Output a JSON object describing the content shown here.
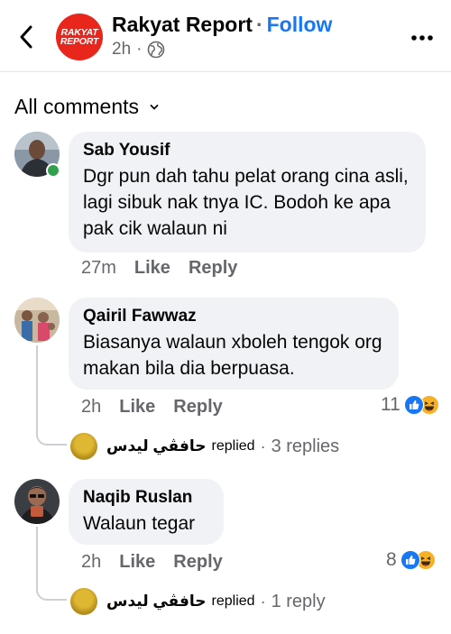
{
  "header": {
    "logo_line1": "RAKYAT",
    "logo_line2": "REPORT",
    "page_name": "Rakyat Report",
    "separator": "·",
    "follow_label": "Follow",
    "time": "2h",
    "time_sep": "·",
    "privacy_icon": "globe-icon"
  },
  "filter": {
    "label": "All comments"
  },
  "comments": [
    {
      "author": "Sab Yousif",
      "text": "Dgr pun dah tahu pelat orang cina asli, lagi sibuk nak tnya IC. Bodoh ke apa pak cik walaun ni",
      "time": "27m",
      "like_label": "Like",
      "reply_label": "Reply",
      "online": true
    },
    {
      "author": "Qairil Fawwaz",
      "text": "Biasanya walaun xboleh tengok org makan bila dia berpuasa.",
      "time": "2h",
      "like_label": "Like",
      "reply_label": "Reply",
      "reaction_count": "11",
      "reactions": [
        "like-icon",
        "haha-icon"
      ],
      "replies": {
        "replier_name": "حافڤي ليدس",
        "replied_word": "replied",
        "sep": "·",
        "count_text": "3 replies"
      }
    },
    {
      "author": "Naqib Ruslan",
      "text": "Walaun tegar",
      "time": "2h",
      "like_label": "Like",
      "reply_label": "Reply",
      "reaction_count": "8",
      "reactions": [
        "like-icon",
        "haha-icon"
      ],
      "replies": {
        "replier_name": "حافڤي ليدس",
        "replied_word": "replied",
        "sep": "·",
        "count_text": "1 reply"
      }
    }
  ],
  "colors": {
    "accent": "#1877f2",
    "logo_red": "#e8261c",
    "bubble": "#f0f2f5",
    "secondary_text": "#65676b",
    "online": "#31a24c"
  }
}
